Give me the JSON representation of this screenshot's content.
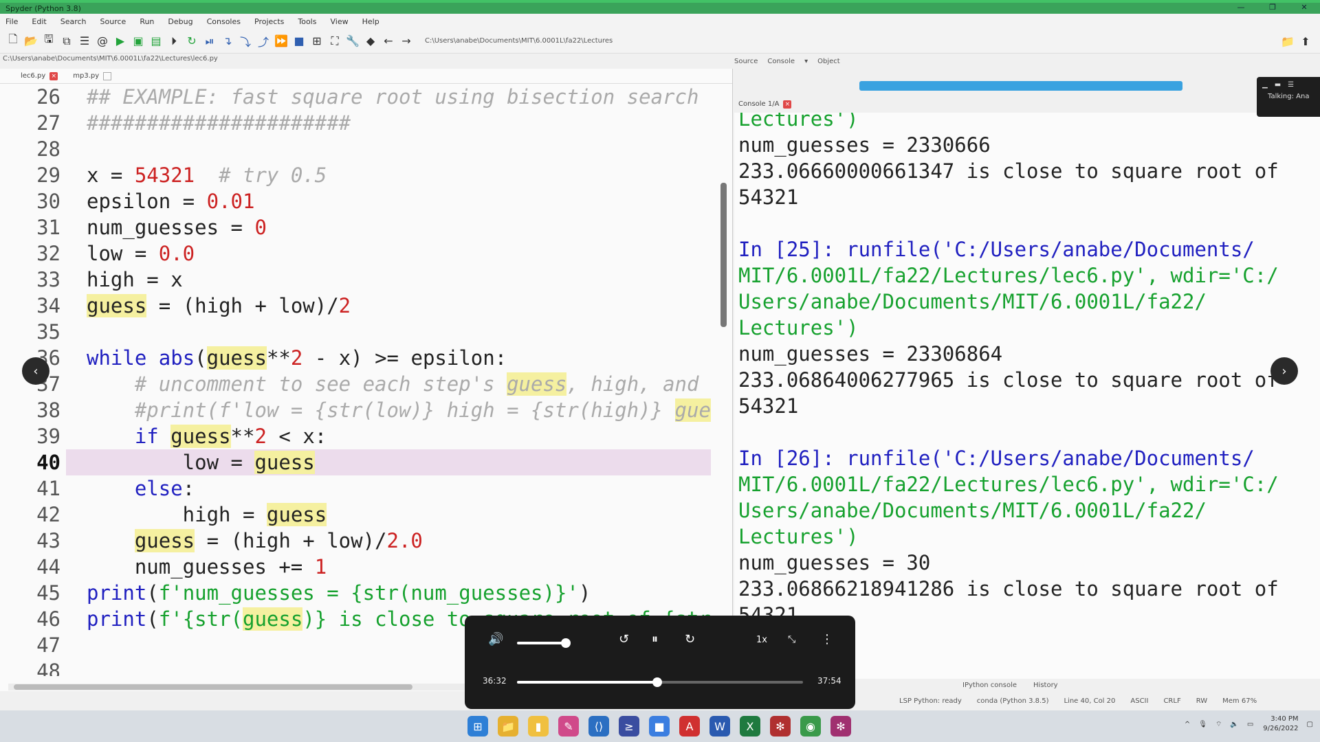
{
  "window": {
    "title": "Spyder (Python 3.8)",
    "controls": [
      "—",
      "❐",
      "✕"
    ]
  },
  "menu": [
    "File",
    "Edit",
    "Search",
    "Source",
    "Run",
    "Debug",
    "Consoles",
    "Projects",
    "Tools",
    "View",
    "Help"
  ],
  "toolbar": {
    "path": "C:\\Users\\anabe\\Documents\\MIT\\6.0001L\\fa22\\Lectures"
  },
  "editor": {
    "file_path": "C:\\Users\\anabe\\Documents\\MIT\\6.0001L\\fa22\\Lectures\\lec6.py",
    "tabs": [
      "lec6.py",
      "mp3.py"
    ],
    "active_line": "40"
  },
  "right_pane": {
    "tabs": [
      "Source",
      "Console",
      "▾",
      "Object"
    ],
    "console_tab": "Console 1/A"
  },
  "console_lines": [
    "Lectures')",
    "num_guesses = 2330666",
    "233.06660000661347 is close to square root of",
    "54321",
    "",
    "In [25]: runfile('C:/Users/anabe/Documents/",
    "MIT/6.0001L/fa22/Lectures/lec6.py', wdir='C:/",
    "Users/anabe/Documents/MIT/6.0001L/fa22/",
    "Lectures')",
    "num_guesses = 23306864",
    "233.06864006277965 is close to square root of",
    "54321",
    "",
    "In [26]: runfile('C:/Users/anabe/Documents/",
    "MIT/6.0001L/fa22/Lectures/lec6.py', wdir='C:/",
    "Users/anabe/Documents/MIT/6.0001L/fa22/",
    "Lectures')",
    "num_guesses = 30",
    "233.06866218941286 is close to square root of",
    "54321"
  ],
  "zoom_panel": {
    "label": "Talking: Ana"
  },
  "status": {
    "items": [
      "LSP Python: ready",
      "conda (Python 3.8.5)",
      "Line 40, Col 20",
      "ASCII",
      "CRLF",
      "RW",
      "Mem 67%"
    ],
    "panel_tabs": [
      "IPython console",
      "History"
    ]
  },
  "player": {
    "current_time": "36:32",
    "total_time": "37:54",
    "speed": "1x",
    "volume": 0.5,
    "progress": 0.487
  },
  "tray": {
    "time": "3:40 PM",
    "date": "9/26/2022"
  },
  "colors": {
    "accent": "#3aa35a",
    "keyword": "#2020c0",
    "string": "#16a12e",
    "number": "#c22222"
  }
}
